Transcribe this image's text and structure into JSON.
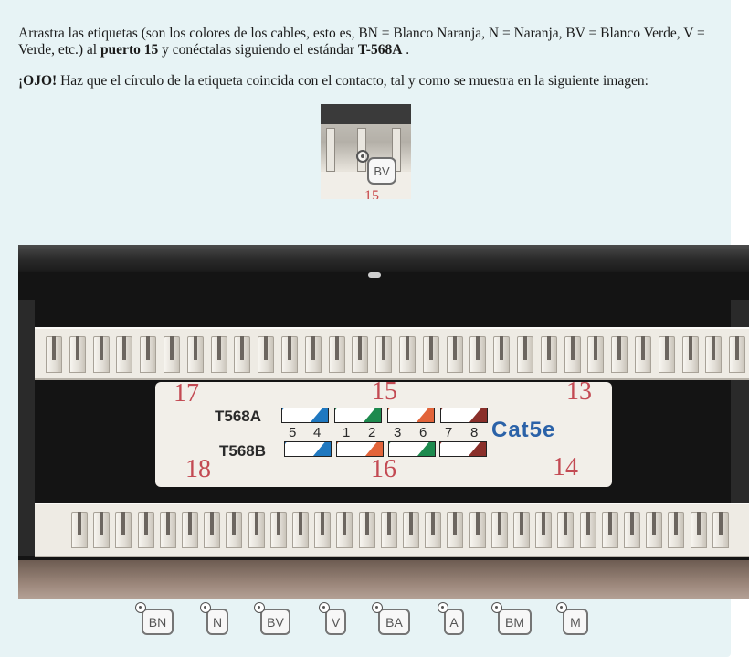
{
  "instructions": {
    "line1_pre": "Arrastra las etiquetas (son los colores de los cables, esto es, BN = Blanco Naranja, N = Naranja, BV = Blanco Verde, V = Verde, etc.) al ",
    "line1_bold1": "puerto 15",
    "line1_mid": " y conéctalas siguiendo el estándar ",
    "line1_bold2": "T-568A",
    "line1_end": " .",
    "line2_bold": "¡OJO!",
    "line2_rest": " Haz que el círculo de la etiqueta coincida con el contacto, tal y como se muestra en la siguiente imagen:"
  },
  "sample_image": {
    "tag_label": "BV",
    "port_number_partial": "15"
  },
  "patch_panel": {
    "port_numbers": [
      "17",
      "15",
      "13",
      "18",
      "16",
      "14"
    ],
    "standard_a": "T568A",
    "standard_b": "T568B",
    "pin_numbers": [
      "5",
      "4",
      "1",
      "2",
      "3",
      "6",
      "7",
      "8"
    ],
    "category": "Cat5e",
    "colors": {
      "blue": "#1f78c0",
      "green": "#1d8a4e",
      "orange": "#e2643a",
      "brown": "#8a2f2a"
    }
  },
  "tags": [
    {
      "label": "BN"
    },
    {
      "label": "N"
    },
    {
      "label": "BV"
    },
    {
      "label": "V"
    },
    {
      "label": "BA"
    },
    {
      "label": "A"
    },
    {
      "label": "BM"
    },
    {
      "label": "M"
    }
  ]
}
